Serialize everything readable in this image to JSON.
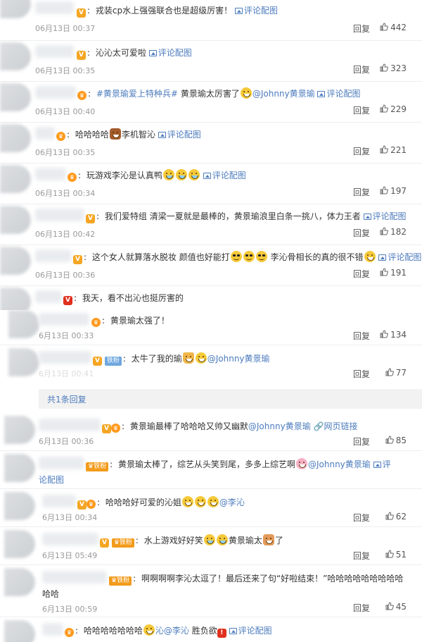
{
  "labels": {
    "reply": "回复",
    "pic": "评论配图",
    "fan_badge": "铁粉",
    "web_link": "网页链接",
    "reply_count": "共1条回复"
  },
  "comments": [
    {
      "text": "戎装cp水上强强联合也是超级厉害！",
      "date": "06月13日 00:37",
      "likes": "442"
    },
    {
      "text": "沁沁太可爱啦",
      "date": "06月13日 00:35",
      "likes": "323"
    },
    {
      "text_a": "#黄景瑜爱上特种兵#",
      "text_b": "黄景瑜太厉害了",
      "mention": "@Johnny黄景瑜",
      "date": "06月13日 00:40",
      "likes": "229"
    },
    {
      "text": "哈哈哈哈",
      "text_b": "李机智沁",
      "date": "06月13日 00:35",
      "likes": "221"
    },
    {
      "text": "玩游戏李沁是认真鸭",
      "date": "06月13日 00:34",
      "likes": "197"
    },
    {
      "text": "我们爱特组 清梁一夏就是最棒的，黄景瑜浪里白条一挑八，体力王者",
      "date": "06月13日 00:42",
      "likes": "182"
    },
    {
      "text": "这个女人就算落水脱妆 颜值也好能打",
      "text_b": "李沁骨相长的真的很不错",
      "date": "06月13日 00:36",
      "likes": "191"
    },
    {
      "text": "我天，看不出沁也挺厉害的"
    },
    {
      "text": "黄景瑜太强了！",
      "date": "6月13日 00:33",
      "likes": "134"
    },
    {
      "text": "太牛了我的瑜",
      "mention": "@Johnny黄景瑜",
      "date": "6月13日 00:41",
      "likes": "77"
    },
    {
      "text": "黄景瑜最棒了哈哈哈又帅又幽默",
      "mention": "@Johnny黄景瑜",
      "date": "6月13日 00:36",
      "likes": "85"
    },
    {
      "text": "黄景瑜太棒了，综艺从头笑到尾，多多上综艺啊",
      "mention": "@Johnny黄景瑜",
      "pic_a": "评",
      "pic_b": "论配图"
    },
    {
      "text": "哈哈哈好可爱的沁姐",
      "mention": "@李沁",
      "date": "6月13日 00:34",
      "likes": "62"
    },
    {
      "text": "水上游戏好好笑",
      "text_b": "黄景瑜太",
      "text_c": "了",
      "date": "6月13日 05:49",
      "likes": "51"
    },
    {
      "text": "啊啊啊啊李沁太逗了！最后还来了句“好啦结束！”哈哈哈哈哈哈哈哈哈",
      "text_2": "哈哈",
      "date": "6月13日 00:59",
      "likes": "45"
    },
    {
      "text": "哈哈哈哈哈哈哈",
      "mention": "沁@李沁",
      "text_b": "胜负欲"
    }
  ]
}
